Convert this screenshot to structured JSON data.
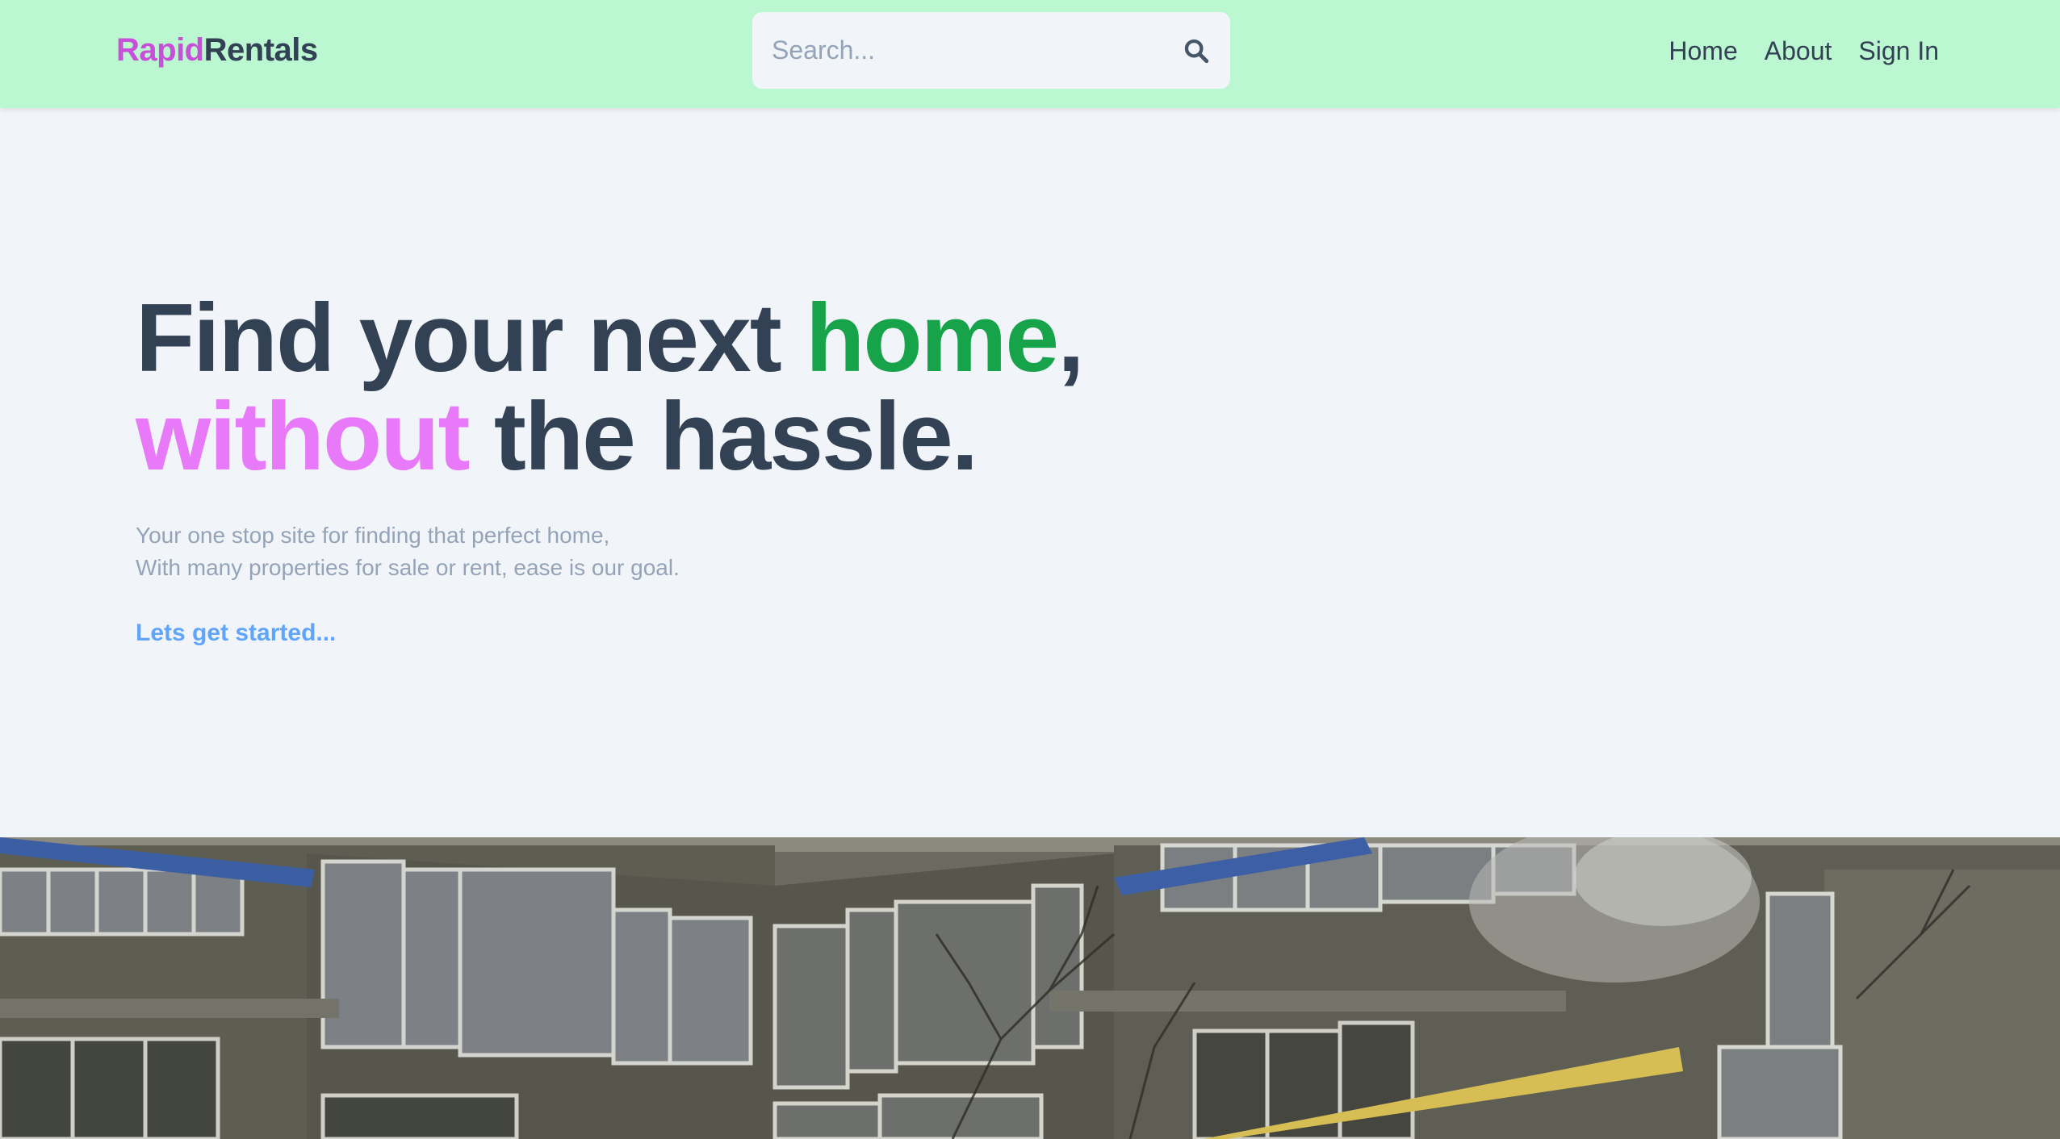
{
  "header": {
    "logo_part1": "Rapid",
    "logo_part2": "Rentals",
    "search": {
      "placeholder": "Search...",
      "value": ""
    },
    "nav": [
      "Home",
      "About",
      "Sign In"
    ]
  },
  "hero": {
    "line1_part1": "Find your next ",
    "line1_highlight": "home",
    "line1_part2": ",",
    "line2_highlight": "without",
    "line2_part2": " the hassle.",
    "sub_line1": "Your one stop site for finding that perfect home,",
    "sub_line2": "With many properties for sale or rent, ease is our goal.",
    "cta": "Lets get started..."
  },
  "colors": {
    "header_bg": "#bbf7d0",
    "page_bg": "#f1f5f9",
    "brand_pink": "#c84fd8",
    "highlight_green": "#16a34a",
    "highlight_pink": "#e879f9",
    "link_blue": "#60a5fa",
    "text_dark": "#334155"
  },
  "icons": {
    "search": "search-icon"
  }
}
